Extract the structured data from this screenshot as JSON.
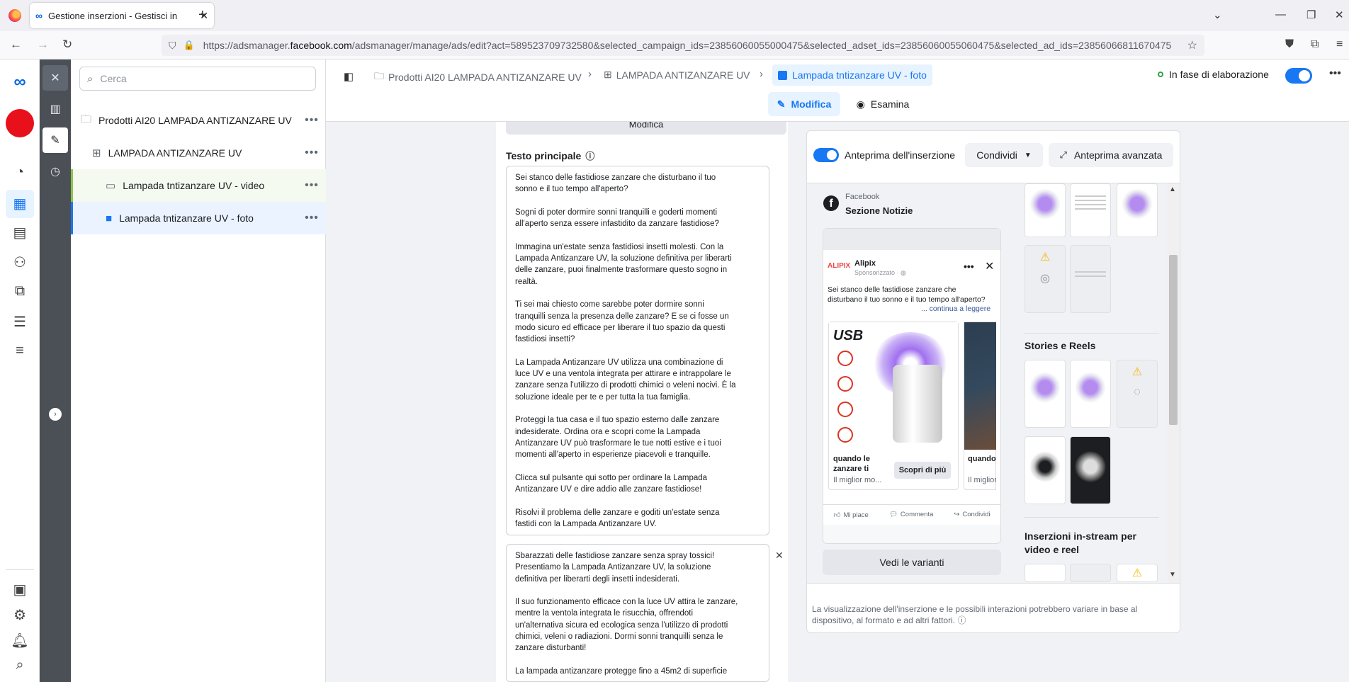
{
  "browser": {
    "tab_title": "Gestione inserzioni - Gestisci in",
    "new_tab": "+",
    "url_prefix": "https://adsmanager.",
    "url_domain": "facebook.com",
    "url_rest": "/adsmanager/manage/ads/edit?act=589523709732580&selected_campaign_ids=23856060055000475&selected_adset_ids=23856060055060475&selected_ad_ids=23856066811670475"
  },
  "sidebar_tree": {
    "search_placeholder": "Cerca",
    "campaign": "Prodotti AI20 LAMPADA ANTIZANZARE UV",
    "adset": "LAMPADA ANTIZANZARE UV",
    "ad_video": "Lampada tntizanzare UV - video",
    "ad_foto": "Lampada tntizanzare UV - foto",
    "more": "•••"
  },
  "header": {
    "crumb_campaign": "Prodotti AI20 LAMPADA ANTIZANZARE UV",
    "crumb_adset": "LAMPADA ANTIZANZARE UV",
    "crumb_ad": "Lampada tntizanzare UV - foto",
    "status": "In fase di elaborazione",
    "modifica": "Modifica",
    "esamina": "Esamina",
    "more": "•••"
  },
  "editor": {
    "modifica_strip": "Modifica",
    "primary_text_label": "Testo principale",
    "primary_text_1": "Sei stanco delle fastidiose zanzare che disturbano il tuo\nsonno e il tuo tempo all'aperto?\n\nSogni di poter dormire sonni tranquilli e goderti momenti\nall'aperto senza essere infastidito da zanzare fastidiose?\n\nImmagina un'estate senza fastidiosi insetti molesti. Con la\nLampada Antizanzare UV, la soluzione definitiva per liberarti\ndelle zanzare, puoi finalmente trasformare questo sogno in\nrealtà.\n\nTi sei mai chiesto come sarebbe poter dormire sonni\ntranquilli senza la presenza delle zanzare? E se ci fosse un\nmodo sicuro ed efficace per liberare il tuo spazio da questi\nfastidiosi insetti?\n\nLa Lampada Antizanzare UV utilizza una combinazione di\nluce UV e una ventola integrata per attirare e intrappolare le\nzanzare senza l'utilizzo di prodotti chimici o veleni nocivi. È la\nsoluzione ideale per te e per tutta la tua famiglia.\n\nProteggi la tua casa e il tuo spazio esterno dalle zanzare\nindesiderate. Ordina ora e scopri come la Lampada\nAntizanzare UV può trasformare le tue notti estive e i tuoi\nmomenti all'aperto in esperienze piacevoli e tranquille.\n\nClicca sul pulsante qui sotto per ordinare la Lampada\nAntizanzare UV e dire addio alle zanzare fastidiose!\n\nRisolvi il problema delle zanzare e goditi un'estate senza\nfastidi con la Lampada Antizanzare UV.",
    "primary_text_2": "Sbarazzati delle fastidiose zanzare senza spray tossici!\nPresentiamo la Lampada Antizanzare UV, la soluzione\ndefinitiva per liberarti degli insetti indesiderati.\n\nIl suo funzionamento efficace con la luce UV attira le zanzare,\nmentre la ventola integrata le risucchia, offrendoti\nun'alternativa sicura ed ecologica senza l'utilizzo di prodotti\nchimici, veleni o radiazioni. Dormi sonni tranquilli senza le\nzanzare disturbanti!\n\nLa lampada antizanzare protegge fino a 45m2 di superficie"
  },
  "preview": {
    "toggle_label": "Anteprima dell'inserzione",
    "share": "Condividi",
    "advanced": "Anteprima avanzata",
    "platform": "Facebook",
    "placement": "Sezione Notizie",
    "page_logo": "ALIPIX",
    "page_name": "Alipix",
    "sponsored": "Sponsorizzato · ◍",
    "post_text": "Sei stanco delle fastidiose zanzare che disturbano il tuo sonno e il tuo tempo all'aperto?",
    "read_more": "... continua a leggere",
    "card1_title": "quando le zanzare ti",
    "card1_sub": "Il miglior mo...",
    "card1_cta": "Scopri di più",
    "card2_title": "quando le zanzare",
    "card2_sub": "Il miglior",
    "usb": "USB",
    "like": "Mi piace",
    "comment": "Commenta",
    "share_post": "Condividi",
    "variants": "Vedi le varianti",
    "stories_title": "Stories e Reels",
    "instream_title": "Inserzioni in-stream per video e reel",
    "disclaimer": "La visualizzazione dell'inserzione e le possibili interazioni potrebbero variare in base al dispositivo, al formato e ad altri fattori."
  },
  "colors": {
    "accent": "#1877f2",
    "rail_dark": "#4b4f56",
    "status_green": "#31a24c"
  }
}
